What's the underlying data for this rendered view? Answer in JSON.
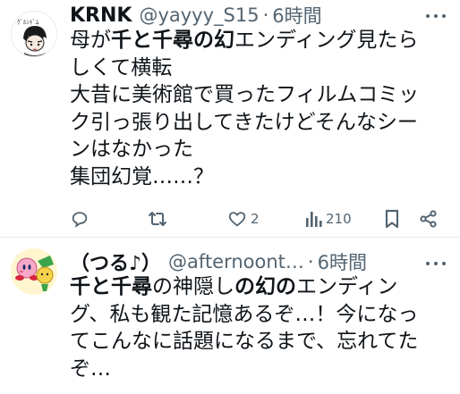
{
  "tweets": [
    {
      "name": "KRNK",
      "handle": "@yayyy_S15",
      "separator": "·",
      "time": "6時間",
      "lines": [
        [
          {
            "text": "母が",
            "bold": false
          },
          {
            "text": "千と千尋の幻",
            "bold": true
          },
          {
            "text": "エンディング見たら",
            "bold": false
          }
        ],
        [
          {
            "text": "しくて横転",
            "bold": false
          }
        ],
        [
          {
            "text": "大昔に美術館で買ったフィルムコミッ",
            "bold": false
          }
        ],
        [
          {
            "text": "ク引っ張り出してきたけどそんなシー",
            "bold": false
          }
        ],
        [
          {
            "text": "ンはなかった",
            "bold": false
          }
        ],
        [
          {
            "text": "集団幻覚……？",
            "bold": false
          }
        ]
      ],
      "actions": {
        "reply_count": "",
        "retweet_count": "",
        "like_count": "2",
        "views_count": "210"
      }
    },
    {
      "name": "（つる♪）",
      "handle": "@afternoont…",
      "separator": "·",
      "time": "6時間",
      "lines": [
        [
          {
            "text": "千と千尋",
            "bold": true
          },
          {
            "text": "の神隠し",
            "bold": false
          },
          {
            "text": "の幻の",
            "bold": true
          },
          {
            "text": "エンディン",
            "bold": false
          }
        ],
        [
          {
            "text": "グ、私も観た記憶あるぞ…！今になっ",
            "bold": false
          }
        ],
        [
          {
            "text": "てこんなに話題になるまで、忘れてた",
            "bold": false
          }
        ],
        [
          {
            "text": "ぞ…",
            "bold": false
          }
        ]
      ]
    }
  ],
  "icons": {
    "reply": "reply-icon",
    "retweet": "retweet-icon",
    "like": "heart-icon",
    "views": "views-icon",
    "bookmark": "bookmark-icon",
    "share": "share-icon",
    "more": "more-dots-icon"
  },
  "colors": {
    "text": "#0f1419",
    "secondary": "#536471",
    "divider": "#e3e6ea"
  }
}
